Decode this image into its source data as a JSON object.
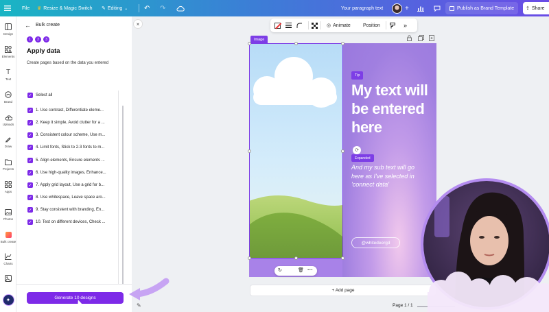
{
  "topbar": {
    "file": "File",
    "resize": "Resize & Magic Switch",
    "editing": "Editing",
    "doc_title": "Your paragraph text",
    "publish": "Publish as Brand Template",
    "share": "Share"
  },
  "rail": [
    {
      "label": "Design",
      "icon": "layout-icon"
    },
    {
      "label": "Elements",
      "icon": "shapes-icon"
    },
    {
      "label": "Text",
      "icon": "text-icon"
    },
    {
      "label": "Brand",
      "icon": "brand-icon"
    },
    {
      "label": "Uploads",
      "icon": "upload-icon"
    },
    {
      "label": "Draw",
      "icon": "pen-icon"
    },
    {
      "label": "Projects",
      "icon": "folder-icon"
    },
    {
      "label": "Apps",
      "icon": "apps-icon"
    },
    {
      "label": "Photos",
      "icon": "photo-icon"
    },
    {
      "label": "Bulk create",
      "icon": "bulk-create-icon"
    },
    {
      "label": "Charts",
      "icon": "chart-icon"
    }
  ],
  "panel": {
    "title": "Bulk create",
    "steps": [
      "1",
      "2",
      "3"
    ],
    "heading": "Apply data",
    "subheading": "Create pages based on the data you entered",
    "select_all": "Select all",
    "rows": [
      "1. Use contrast, Differentiate eleme...",
      "2. Keep it simple, Avoid clutter for a ...",
      "3. Consistent colour scheme, Use m...",
      "4. Limit fonts, Stick to 2-3 fonts to m...",
      "5. Align elements, Ensure elements ...",
      "6. Use high-quality images, Enhance...",
      "7. Apply grid layout, Use a grid for b...",
      "8. Use whitespace, Leave space aro...",
      "9. Stay consistent with branding, En...",
      "10. Test on different devices, Check ..."
    ],
    "generate": "Generate 10 designs"
  },
  "toolbar": {
    "animate": "Animate",
    "position": "Position"
  },
  "design": {
    "image_label": "Image",
    "tip": "Tip",
    "headline": "My text will be entered here",
    "expanded": "Expanded",
    "subtext": "And my sub text will go here as I've selected in 'connect data'",
    "handle": "@whitedeergd"
  },
  "add_page": "+ Add page",
  "page_count": "Page 1 / 1",
  "colors": {
    "accent": "#7d2ae8",
    "design_purple": "#a882e8"
  }
}
